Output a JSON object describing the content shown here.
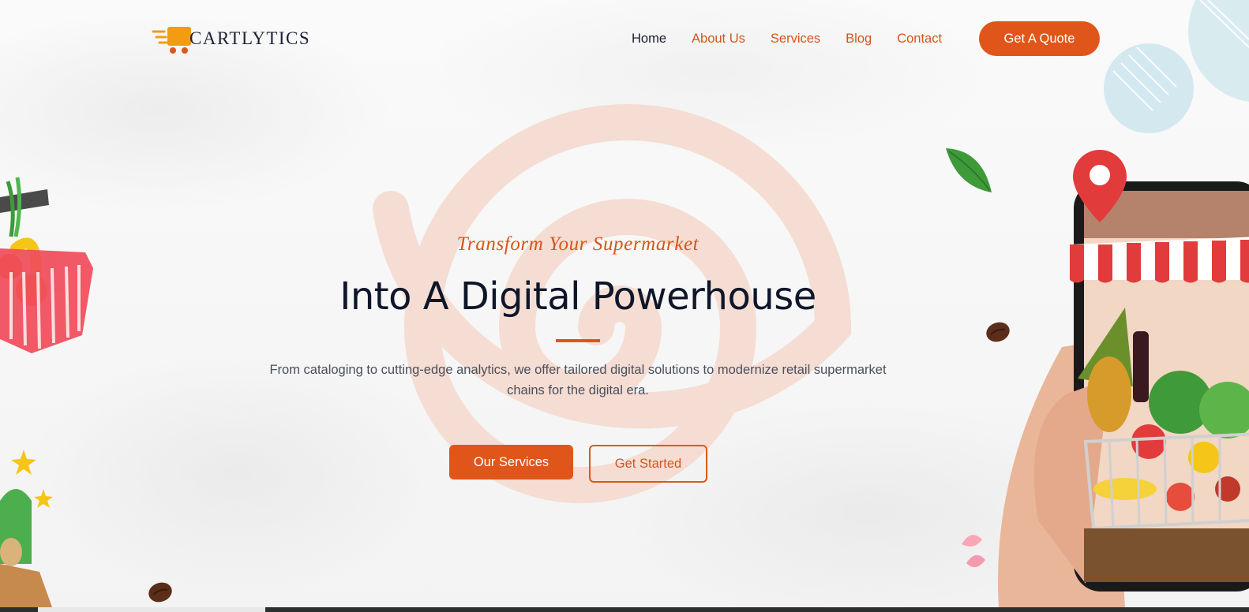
{
  "brand": {
    "logo_text": "CARTLYTICS"
  },
  "nav": {
    "items": [
      {
        "label": "Home",
        "active": true
      },
      {
        "label": "About Us",
        "active": false
      },
      {
        "label": "Services",
        "active": false
      },
      {
        "label": "Blog",
        "active": false
      },
      {
        "label": "Contact",
        "active": false
      }
    ],
    "cta_label": "Get A Quote"
  },
  "hero": {
    "eyebrow": "Transform Your Supermarket",
    "headline": "Into A Digital Powerhouse",
    "lead": "From cataloging to cutting-edge analytics, we offer tailored digital solutions to modernize retail supermarket chains for the digital era.",
    "primary_button": "Our Services",
    "secondary_button": "Get Started"
  },
  "colors": {
    "accent": "#e0561a",
    "heading": "#0f1629",
    "body_text": "#4a4f5c"
  },
  "icons": [
    "cart-logo-icon",
    "grocery-basket-illustration",
    "phone-storefront-illustration",
    "leaf-icon",
    "coffee-bean-icon",
    "star-sparkle-icon",
    "map-pin-icon"
  ]
}
